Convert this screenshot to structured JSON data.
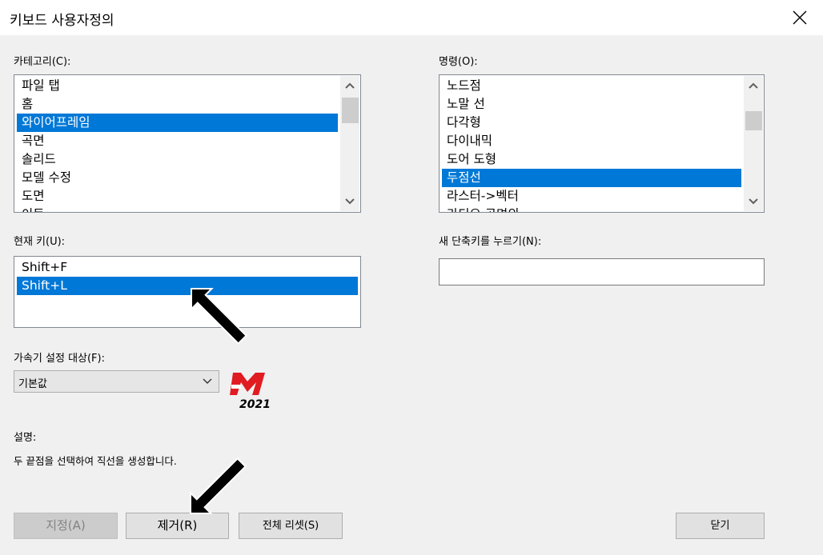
{
  "window": {
    "title": "키보드 사용자정의",
    "close_icon": "close-icon"
  },
  "category": {
    "label": "카테고리(C):",
    "items": [
      {
        "text": "파일 탭",
        "selected": false
      },
      {
        "text": "홈",
        "selected": false
      },
      {
        "text": "와이어프레임",
        "selected": true
      },
      {
        "text": "곡면",
        "selected": false
      },
      {
        "text": "솔리드",
        "selected": false
      },
      {
        "text": "모델 수정",
        "selected": false
      },
      {
        "text": "도면",
        "selected": false
      },
      {
        "text": "이동",
        "selected": false
      }
    ]
  },
  "command": {
    "label": "명령(O):",
    "items": [
      {
        "text": "노드점",
        "selected": false
      },
      {
        "text": "노말 선",
        "selected": false
      },
      {
        "text": "다각형",
        "selected": false
      },
      {
        "text": "다이내믹",
        "selected": false
      },
      {
        "text": "도어 도형",
        "selected": false
      },
      {
        "text": "두점선",
        "selected": true
      },
      {
        "text": "라스터->벡터",
        "selected": false
      },
      {
        "text": "라디오 곡면의",
        "selected": false
      }
    ]
  },
  "current_keys": {
    "label": "현재 키(U):",
    "items": [
      {
        "text": "Shift+F",
        "selected": false
      },
      {
        "text": "Shift+L",
        "selected": true
      }
    ]
  },
  "new_shortcut": {
    "label": "새 단축키를 누르기(N):",
    "value": ""
  },
  "accelerator": {
    "label": "가속기 설정 대상(F):",
    "value": "기본값"
  },
  "logo": {
    "year": "2021",
    "brand_color": "#e11b22"
  },
  "description": {
    "label": "설명:",
    "text": "두 끝점을 선택하여 직선을 생성합니다."
  },
  "buttons": {
    "assign": "지정(A)",
    "remove": "제거(R)",
    "reset_all": "전체 리셋(S)",
    "close": "닫기"
  },
  "colors": {
    "selection": "#0078d7",
    "annotation_arrow": "#000000"
  }
}
